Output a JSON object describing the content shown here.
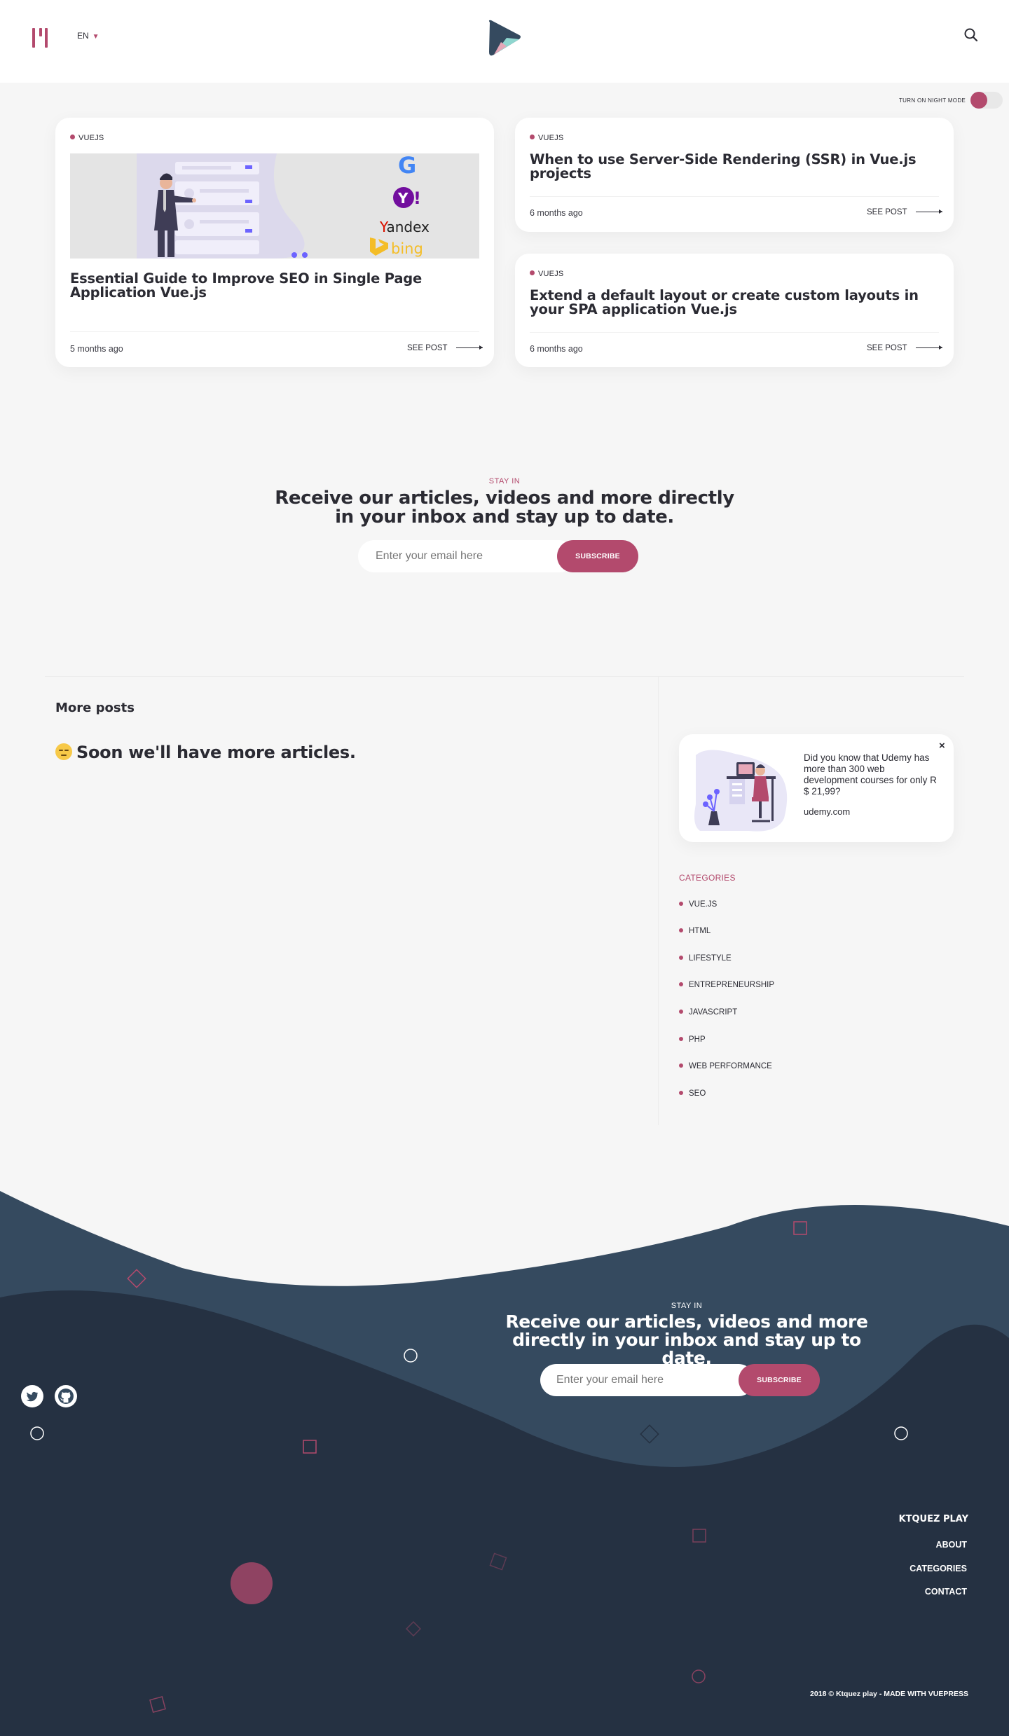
{
  "header": {
    "language": "EN",
    "night_mode_label": "TURN ON NIGHT MODE"
  },
  "featured_posts": [
    {
      "tag": "VUEJS",
      "title": "Essential Guide to Improve SEO in Single Page Application Vue.js",
      "date": "5 months ago",
      "cta": "SEE POST",
      "image_labels": [
        "Yandex",
        "bing"
      ]
    },
    {
      "tag": "VUEJS",
      "title": "When to use Server-Side Rendering (SSR) in Vue.js projects",
      "date": "6 months ago",
      "cta": "SEE POST"
    },
    {
      "tag": "VUEJS",
      "title": "Extend a default layout or create custom layouts in your SPA application Vue.js",
      "date": "6 months ago",
      "cta": "SEE POST"
    }
  ],
  "newsletter": {
    "eyebrow": "STAY IN",
    "title_line1": "Receive our articles, videos and more directly",
    "title_line2": "in your inbox and stay up to date.",
    "placeholder": "Enter your email here",
    "button": "SUBSCRIBE"
  },
  "more_posts": {
    "title": "More posts",
    "empty_message": "Soon we'll have more articles."
  },
  "ad": {
    "close": "×",
    "text": "Did you know that Udemy has more than 300 web development courses for only R $ 21,99?",
    "link": "udemy.com"
  },
  "categories": {
    "title": "CATEGORIES",
    "items": [
      "VUE.JS",
      "HTML",
      "LIFESTYLE",
      "ENTREPRENEURSHIP",
      "JAVASCRIPT",
      "PHP",
      "WEB PERFORMANCE",
      "SEO"
    ]
  },
  "footer": {
    "newsletter": {
      "eyebrow": "STAY IN",
      "title_line1": "Receive our articles, videos and more",
      "title_line2": "directly in your inbox and stay up to date.",
      "placeholder": "Enter your email here",
      "button": "SUBSCRIBE"
    },
    "social": [
      "twitter-icon",
      "github-icon"
    ],
    "brand": "KTQUEZ PLAY",
    "links": [
      "ABOUT",
      "CATEGORIES",
      "CONTACT"
    ],
    "copyright": "2018 © Ktquez play - MADE WITH VUEPRESS"
  },
  "colors": {
    "accent": "#b34a6d",
    "text": "#2b2b33",
    "background": "#f6f6f6",
    "footer_dark": "#253142",
    "footer_light": "#354a5f"
  }
}
